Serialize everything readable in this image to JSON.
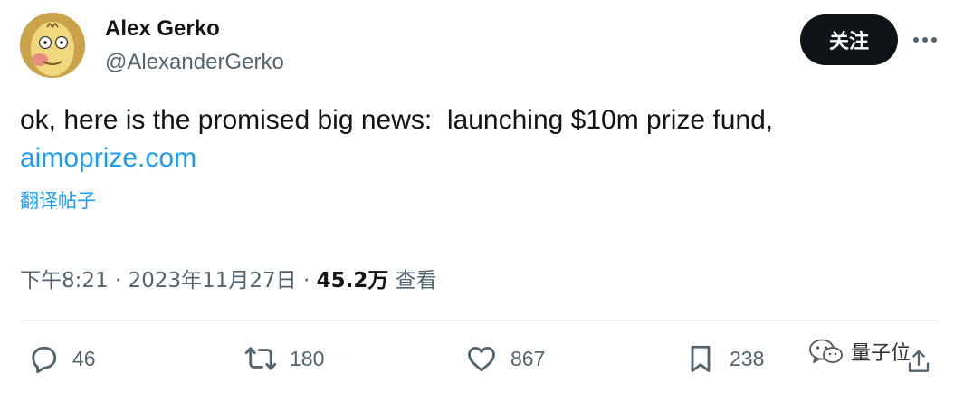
{
  "author": {
    "name": "Alex Gerko",
    "handle": "@AlexanderGerko"
  },
  "header": {
    "follow_label": "关注",
    "more_icon": "more-horizontal-icon"
  },
  "tweet": {
    "text": "ok, here is the promised big news:  launching $10m prize fund,",
    "link": "aimoprize.com",
    "translate_label": "翻译帖子"
  },
  "meta": {
    "time": "下午8:21",
    "separator": " · ",
    "date": "2023年11月27日",
    "views_count": "45.2万",
    "views_label": "查看"
  },
  "actions": {
    "replies": "46",
    "retweets": "180",
    "likes": "867",
    "bookmarks": "238"
  },
  "watermark": {
    "text": "量子位"
  },
  "colors": {
    "link": "#1d9bf0",
    "secondary_text": "#536471",
    "primary_text": "#0f1419",
    "follow_button_bg": "#0f1419"
  }
}
